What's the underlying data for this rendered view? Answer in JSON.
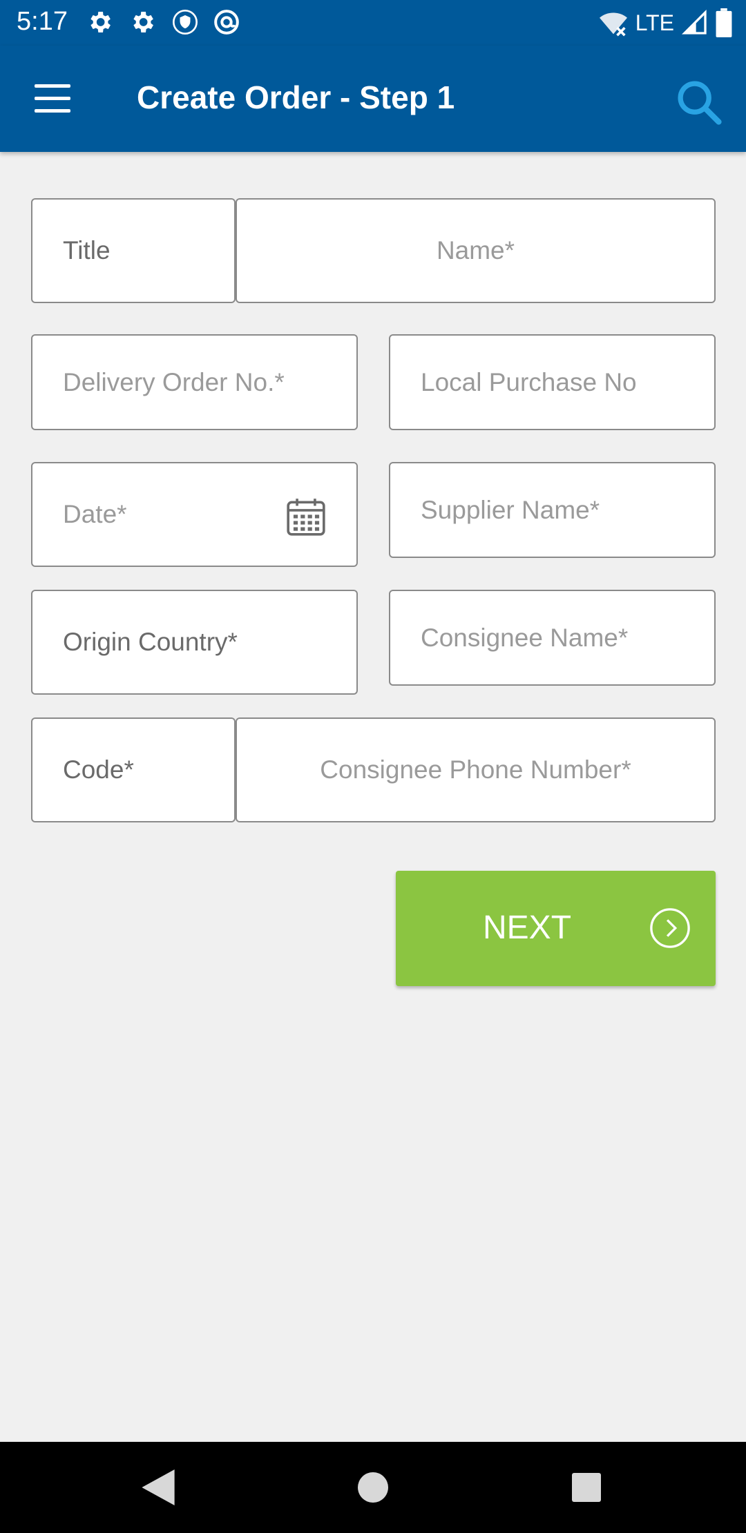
{
  "status_bar": {
    "time": "5:17",
    "network": "LTE",
    "icons": [
      "gear-icon",
      "gear-icon",
      "shield-icon",
      "at-sign-icon",
      "wifi-off-icon",
      "signal-icon",
      "battery-icon"
    ]
  },
  "app_bar": {
    "title": "Create Order - Step 1",
    "menu_icon": "hamburger-menu-icon",
    "search_icon": "search-icon"
  },
  "form": {
    "title_label": "Title",
    "name_placeholder": "Name*",
    "delivery_order_placeholder": "Delivery Order No.*",
    "local_purchase_placeholder": "Local Purchase No",
    "date_placeholder": "Date*",
    "supplier_name_placeholder": "Supplier Name*",
    "origin_country_label": "Origin Country*",
    "consignee_name_placeholder": "Consignee Name*",
    "code_label": "Code*",
    "consignee_phone_placeholder": "Consignee Phone Number*"
  },
  "next_button": {
    "label": "NEXT",
    "icon": "chevron-right-circle-icon"
  },
  "colors": {
    "primary": "#00599a",
    "accent": "#8bc541",
    "search_icon": "#29a3e3",
    "background": "#f0f0f0"
  }
}
